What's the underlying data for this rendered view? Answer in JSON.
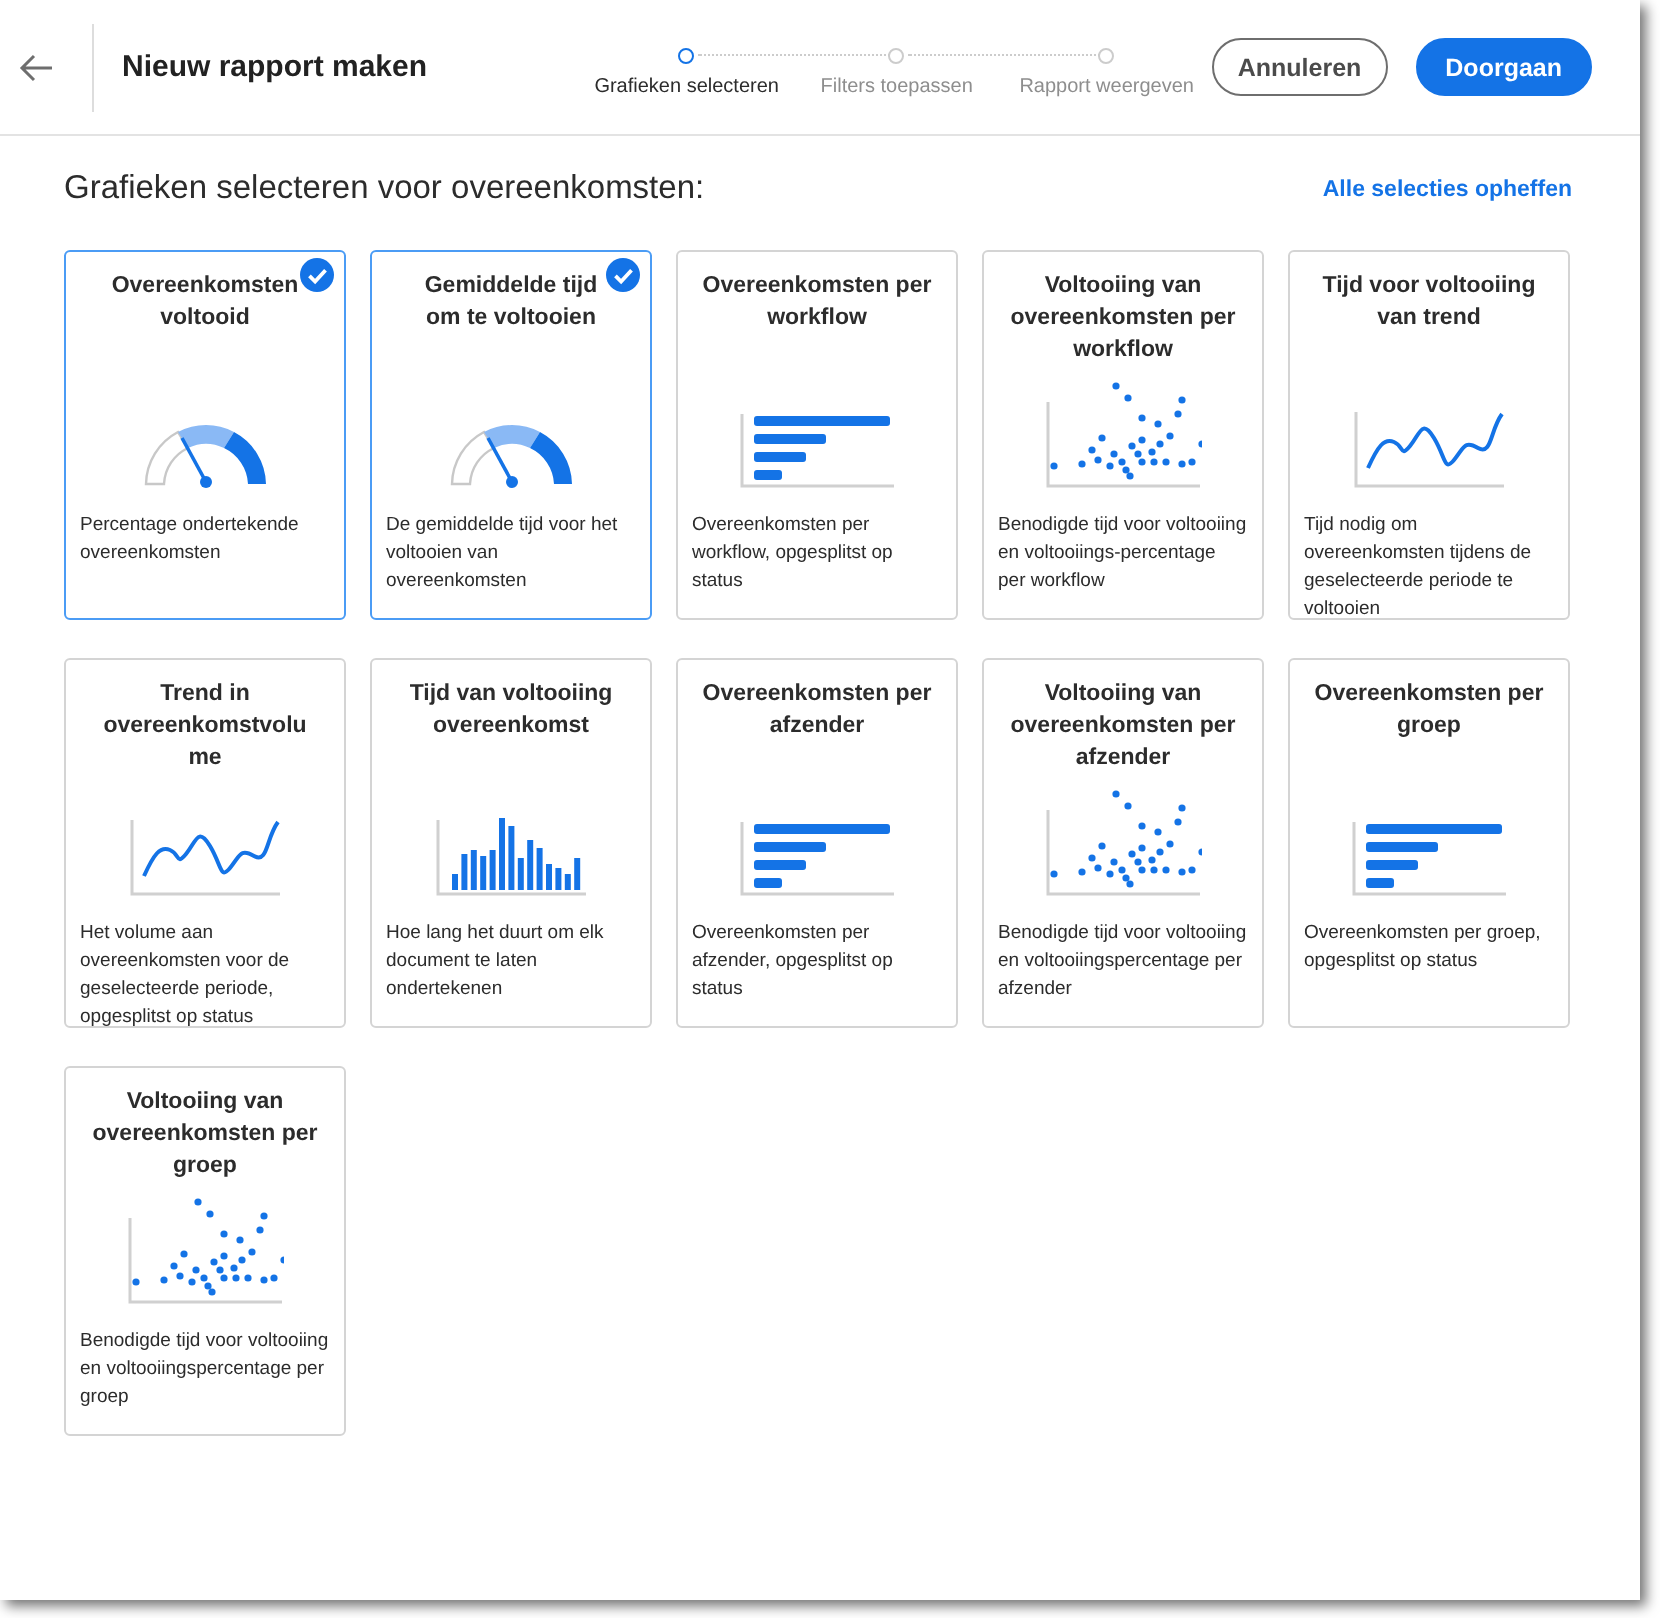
{
  "header": {
    "title": "Nieuw rapport maken",
    "steps": [
      {
        "label": "Grafieken selecteren",
        "selected": true
      },
      {
        "label": "Filters toepassen",
        "selected": false
      },
      {
        "label": "Rapport weergeven",
        "selected": false
      }
    ],
    "buttons": [
      {
        "label": "Annuleren",
        "kind": "secondary"
      },
      {
        "label": "Doorgaan",
        "kind": "primary"
      }
    ]
  },
  "heading": "Grafieken selecteren voor overeenkomsten:",
  "clear_link": "Alle selecties opheffen",
  "cards": [
    {
      "title": "Overeenkomsten voltooid",
      "kind": "gauge",
      "description": "Percentage ondertekende overeenkomsten",
      "selected": true
    },
    {
      "title": "Gemiddelde tijd om te voltooien",
      "kind": "gauge",
      "description": "De gemiddelde tijd voor het voltooien van overeenkomsten",
      "selected": true
    },
    {
      "title": "Overeenkomsten per workflow",
      "kind": "bars",
      "description": "Overeenkomsten per workflow, opgesplitst op status",
      "selected": false
    },
    {
      "title": "Voltooiing van overeenkomsten per workflow",
      "kind": "scatter",
      "description": "Benodigde tijd voor voltooiing en voltooiings-percentage per workflow",
      "selected": false
    },
    {
      "title": "Tijd voor voltooiing van trend",
      "kind": "line",
      "description": "Tijd nodig om overeenkomsten tijdens de geselecteerde periode te voltooien",
      "selected": false
    },
    {
      "title": "Trend in overeenkomstvolu me",
      "kind": "line",
      "description": "Het volume aan overeenkomsten voor de geselecteerde periode, opgesplitst op status",
      "selected": false
    },
    {
      "title": "Tijd van voltooiing overeenkomst",
      "kind": "histogram",
      "description": "Hoe lang het duurt om elk document te laten ondertekenen",
      "selected": false
    },
    {
      "title": "Overeenkomsten per afzender",
      "kind": "bars",
      "description": "Overeenkomsten per afzender, opgesplitst op status",
      "selected": false
    },
    {
      "title": "Voltooiing van overeenkomsten per afzender",
      "kind": "scatter",
      "description": "Benodigde tijd voor voltooiing en voltooiingspercentage per afzender",
      "selected": false
    },
    {
      "title": "Overeenkomsten per groep",
      "kind": "bars",
      "description": "Overeenkomsten per groep, opgesplitst op status",
      "selected": false
    },
    {
      "title": "Voltooiing van overeenkomsten per groep",
      "kind": "scatter",
      "description": "Benodigde tijd voor voltooiing en voltooiingspercentage per groep",
      "selected": false
    }
  ]
}
